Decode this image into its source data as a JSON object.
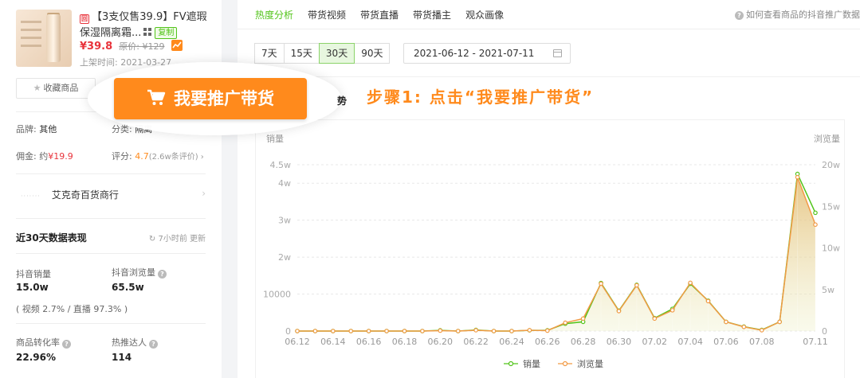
{
  "product": {
    "title_line1": "【3支仅售39.9】FV遮瑕",
    "title_line2": "保湿隔离霜...",
    "copy_label": "复制",
    "price": "¥39.8",
    "original_price": "原价: ¥129",
    "listed_label": "上架时间: 2021-03-27",
    "favorite_label": "收藏商品",
    "brand_label": "品牌:",
    "brand_value": "其他",
    "category_label": "分类:",
    "category_value": "隔离",
    "commission_label": "佣金: 约",
    "commission_value": "¥19.9",
    "rating_label": "评分:",
    "rating_value": "4.7",
    "rating_count": "(2.6w条评价)",
    "shop_name": "艾克奇百货商行"
  },
  "stats": {
    "title": "近30天数据表现",
    "updated": "7小时前 更新",
    "sales_label": "抖音销量",
    "sales_value": "15.0w",
    "views_label": "抖音浏览量",
    "views_value": "65.5w",
    "ratio_text": "( 视频 2.7% / 直播 97.3% )",
    "conversion_label": "商品转化率",
    "conversion_value": "22.96%",
    "influencer_label": "热推达人",
    "influencer_value": "114"
  },
  "tabs": [
    "热度分析",
    "带货视频",
    "带货直播",
    "带货播主",
    "观众画像"
  ],
  "active_tab": 0,
  "help_text": "如何查看商品的抖音推广数据",
  "ranges": [
    "7天",
    "15天",
    "30天",
    "90天"
  ],
  "active_range": 2,
  "date_range": "2021-06-12  -  2021-07-11",
  "overlay": {
    "promote_label": "我要推广带货",
    "hidden_tail": "势",
    "step_text": "步骤1: 点击“我要推广带货”"
  },
  "colors": {
    "accent_green": "#52c41a",
    "accent_orange": "#ff8a1c",
    "price_red": "#e8333b"
  },
  "chart_data": {
    "type": "line",
    "ylabel_left": "销量",
    "ylabel_right": "浏览量",
    "x": [
      "06.12",
      "06.13",
      "06.14",
      "06.15",
      "06.16",
      "06.17",
      "06.18",
      "06.19",
      "06.20",
      "06.21",
      "06.22",
      "06.23",
      "06.24",
      "06.25",
      "06.26",
      "06.27",
      "06.28",
      "06.29",
      "06.30",
      "07.01",
      "07.02",
      "07.03",
      "07.04",
      "07.05",
      "07.06",
      "07.07",
      "07.08",
      "07.09",
      "07.10",
      "07.11"
    ],
    "x_tick_labels": [
      "06.12",
      "06.14",
      "06.16",
      "06.18",
      "06.20",
      "06.22",
      "06.24",
      "06.26",
      "06.28",
      "06.30",
      "07.02",
      "07.04",
      "07.06",
      "07.08",
      "07.11"
    ],
    "y_left_ticks": [
      "0",
      "10000",
      "2w",
      "3w",
      "4w",
      "4.5w"
    ],
    "y_left_values": [
      0,
      10000,
      20000,
      30000,
      40000,
      45000
    ],
    "y_right_ticks": [
      "0",
      "5w",
      "10w",
      "15w",
      "20w"
    ],
    "y_right_values": [
      0,
      50000,
      100000,
      150000,
      200000
    ],
    "ylim_left": [
      0,
      45000
    ],
    "ylim_right": [
      0,
      200000
    ],
    "series": [
      {
        "name": "销量",
        "axis": "left",
        "color": "#52c41a",
        "values": [
          0,
          0,
          0,
          0,
          0,
          0,
          0,
          0,
          200,
          0,
          300,
          0,
          0,
          200,
          200,
          2000,
          2500,
          13000,
          5500,
          12500,
          3500,
          6000,
          12800,
          8200,
          2500,
          1200,
          300,
          2500,
          42500,
          32000
        ]
      },
      {
        "name": "浏览量",
        "axis": "right",
        "color": "#f29a45",
        "values": [
          0,
          0,
          0,
          0,
          0,
          0,
          0,
          0,
          500,
          0,
          1000,
          0,
          0,
          1000,
          500,
          10000,
          15000,
          57000,
          24000,
          55000,
          15000,
          25000,
          58000,
          36000,
          11000,
          5000,
          1000,
          11000,
          185000,
          128000
        ]
      }
    ],
    "legend_position": "bottom"
  }
}
